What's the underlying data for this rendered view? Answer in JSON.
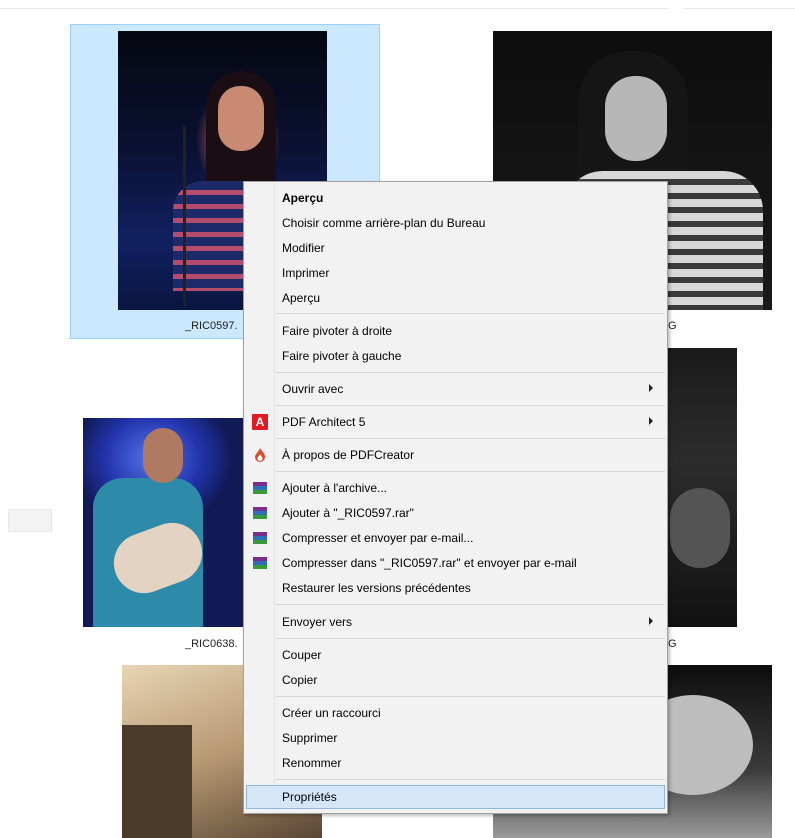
{
  "files": [
    {
      "caption": "_RIC0597.",
      "selected": true
    },
    {
      "caption": "_RIC0638."
    }
  ],
  "right_captions": [
    "G",
    "G"
  ],
  "context_menu": {
    "items": [
      {
        "label": "Aperçu",
        "bold": true
      },
      {
        "label": "Choisir comme arrière-plan du Bureau"
      },
      {
        "label": "Modifier"
      },
      {
        "label": "Imprimer"
      },
      {
        "label": "Aperçu"
      },
      {
        "label": "Faire pivoter à droite"
      },
      {
        "label": "Faire pivoter à gauche"
      },
      {
        "label": "Ouvrir avec",
        "submenu": true
      },
      {
        "label": "PDF Architect 5",
        "submenu": true,
        "icon": "pdf-architect-icon"
      },
      {
        "label": "À propos de PDFCreator",
        "icon": "pdfcreator-icon"
      },
      {
        "label": "Ajouter à l'archive...",
        "icon": "winrar-icon"
      },
      {
        "label": "Ajouter à \"_RIC0597.rar\"",
        "icon": "winrar-icon"
      },
      {
        "label": "Compresser et envoyer par e-mail...",
        "icon": "winrar-icon"
      },
      {
        "label": "Compresser dans \"_RIC0597.rar\" et envoyer par e-mail",
        "icon": "winrar-icon"
      },
      {
        "label": "Restaurer les versions précédentes"
      },
      {
        "label": "Envoyer vers",
        "submenu": true
      },
      {
        "label": "Couper"
      },
      {
        "label": "Copier"
      },
      {
        "label": "Créer un raccourci"
      },
      {
        "label": "Supprimer"
      },
      {
        "label": "Renommer"
      },
      {
        "label": "Propriétés",
        "highlighted": true
      }
    ]
  },
  "colors": {
    "selection_bg": "#cce8ff",
    "selection_border": "#99d1ff",
    "menu_bg": "#f2f2f2",
    "hover_bg": "#d5e6f8",
    "pdf_architect_red": "#e21b23"
  }
}
